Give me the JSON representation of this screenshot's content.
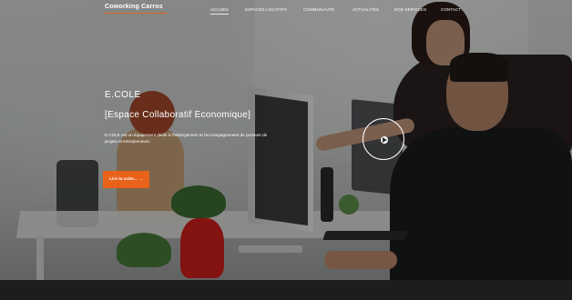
{
  "nav": {
    "brand": "Coworking Carros",
    "links": [
      {
        "label": "ACCUEIL",
        "active": true
      },
      {
        "label": "ESPACES LOCATIFS",
        "active": false
      },
      {
        "label": "COMMUNAUTÉ",
        "active": false
      },
      {
        "label": "ACTUALITÉS",
        "active": false
      },
      {
        "label": "NOS SERVICES",
        "active": false
      },
      {
        "label": "CONTACT",
        "active": false
      }
    ]
  },
  "hero": {
    "title": "E.COLE",
    "subtitle": "[Espace Collaboratif Economique]",
    "text": "E.COLE est un équipement dédié à l'hébergement et l'accompagnement de porteurs de projets et entrepreneurs.",
    "cta_label": "Lire la suite...  →"
  },
  "colors": {
    "accent": "#e8621a",
    "footer": "#1d1d1d"
  },
  "icons": {
    "play": "play-icon"
  }
}
